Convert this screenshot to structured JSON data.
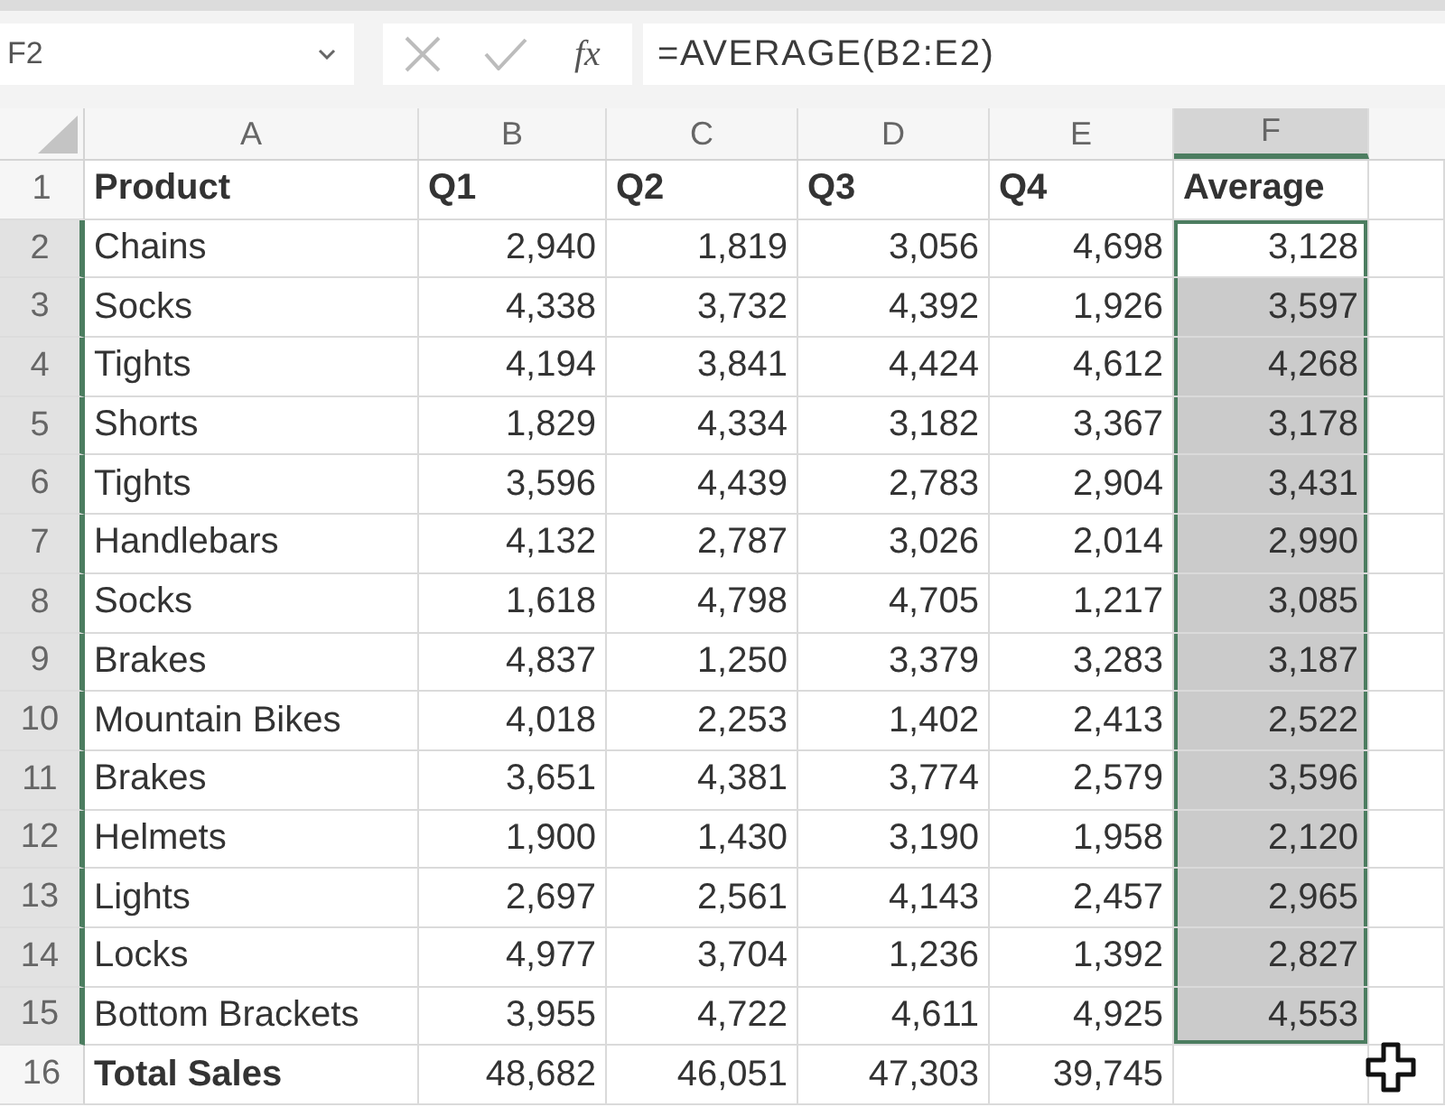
{
  "name_box": {
    "value": "F2"
  },
  "formula_bar": {
    "buttons": [
      {
        "kind": "cancel",
        "disabled": true
      },
      {
        "kind": "enter",
        "disabled": true
      }
    ],
    "function_label": "fx",
    "value": "=AVERAGE(B2:E2)"
  },
  "columns": [
    {
      "label": "A",
      "selected": false
    },
    {
      "label": "B",
      "selected": false
    },
    {
      "label": "C",
      "selected": false
    },
    {
      "label": "D",
      "selected": false
    },
    {
      "label": "E",
      "selected": false
    },
    {
      "label": "F",
      "selected": true
    }
  ],
  "rows": [
    {
      "header": "1",
      "kind": "header",
      "selected": false,
      "cells": [
        "Product",
        "Q1",
        "Q2",
        "Q3",
        "Q4",
        "Average"
      ]
    },
    {
      "header": "2",
      "kind": "data",
      "selected": true,
      "cells": [
        "Chains",
        "2,940",
        "1,819",
        "3,056",
        "4,698",
        "3,128"
      ]
    },
    {
      "header": "3",
      "kind": "data",
      "selected": true,
      "cells": [
        "Socks",
        "4,338",
        "3,732",
        "4,392",
        "1,926",
        "3,597"
      ]
    },
    {
      "header": "4",
      "kind": "data",
      "selected": true,
      "cells": [
        "Tights",
        "4,194",
        "3,841",
        "4,424",
        "4,612",
        "4,268"
      ]
    },
    {
      "header": "5",
      "kind": "data",
      "selected": true,
      "cells": [
        "Shorts",
        "1,829",
        "4,334",
        "3,182",
        "3,367",
        "3,178"
      ]
    },
    {
      "header": "6",
      "kind": "data",
      "selected": true,
      "cells": [
        "Tights",
        "3,596",
        "4,439",
        "2,783",
        "2,904",
        "3,431"
      ]
    },
    {
      "header": "7",
      "kind": "data",
      "selected": true,
      "cells": [
        "Handlebars",
        "4,132",
        "2,787",
        "3,026",
        "2,014",
        "2,990"
      ]
    },
    {
      "header": "8",
      "kind": "data",
      "selected": true,
      "cells": [
        "Socks",
        "1,618",
        "4,798",
        "4,705",
        "1,217",
        "3,085"
      ]
    },
    {
      "header": "9",
      "kind": "data",
      "selected": true,
      "cells": [
        "Brakes",
        "4,837",
        "1,250",
        "3,379",
        "3,283",
        "3,187"
      ]
    },
    {
      "header": "10",
      "kind": "data",
      "selected": true,
      "cells": [
        "Mountain Bikes",
        "4,018",
        "2,253",
        "1,402",
        "2,413",
        "2,522"
      ]
    },
    {
      "header": "11",
      "kind": "data",
      "selected": true,
      "cells": [
        "Brakes",
        "3,651",
        "4,381",
        "3,774",
        "2,579",
        "3,596"
      ]
    },
    {
      "header": "12",
      "kind": "data",
      "selected": true,
      "cells": [
        "Helmets",
        "1,900",
        "1,430",
        "3,190",
        "1,958",
        "2,120"
      ]
    },
    {
      "header": "13",
      "kind": "data",
      "selected": true,
      "cells": [
        "Lights",
        "2,697",
        "2,561",
        "4,143",
        "2,457",
        "2,965"
      ]
    },
    {
      "header": "14",
      "kind": "data",
      "selected": true,
      "cells": [
        "Locks",
        "4,977",
        "3,704",
        "1,236",
        "1,392",
        "2,827"
      ]
    },
    {
      "header": "15",
      "kind": "data",
      "selected": true,
      "cells": [
        "Bottom Brackets",
        "3,955",
        "4,722",
        "4,611",
        "4,925",
        "4,553"
      ]
    },
    {
      "header": "16",
      "kind": "total",
      "selected": false,
      "cells": [
        "Total Sales",
        "48,682",
        "46,051",
        "47,303",
        "39,745"
      ]
    }
  ]
}
